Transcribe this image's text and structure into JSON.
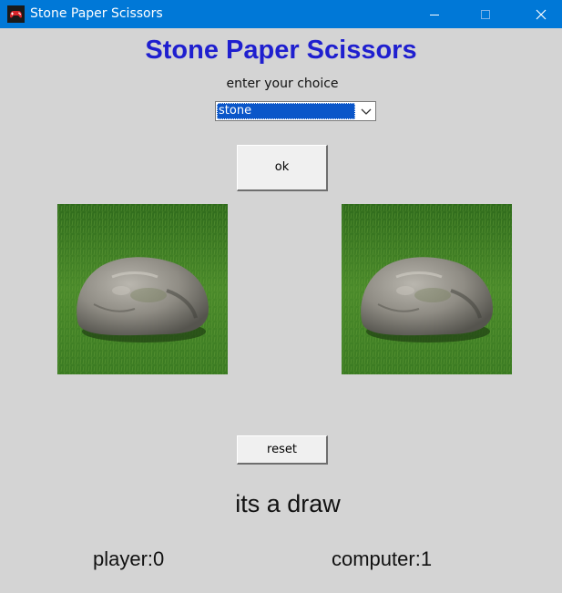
{
  "window": {
    "title": "Stone Paper Scissors",
    "titlebar_color": "#0078d7",
    "icon": "game-controller-icon"
  },
  "heading": "Stone Paper Scissors",
  "prompt": "enter your choice",
  "choice_select": {
    "selected": "stone"
  },
  "buttons": {
    "ok": "ok",
    "reset": "reset"
  },
  "images": {
    "player_choice": "stone",
    "computer_choice": "stone"
  },
  "result": "its a draw",
  "score": {
    "player": "player:0",
    "computer": "computer:1"
  },
  "colors": {
    "heading": "#1f1fcf",
    "background": "#d4d4d4",
    "selection": "#0a56c9"
  }
}
